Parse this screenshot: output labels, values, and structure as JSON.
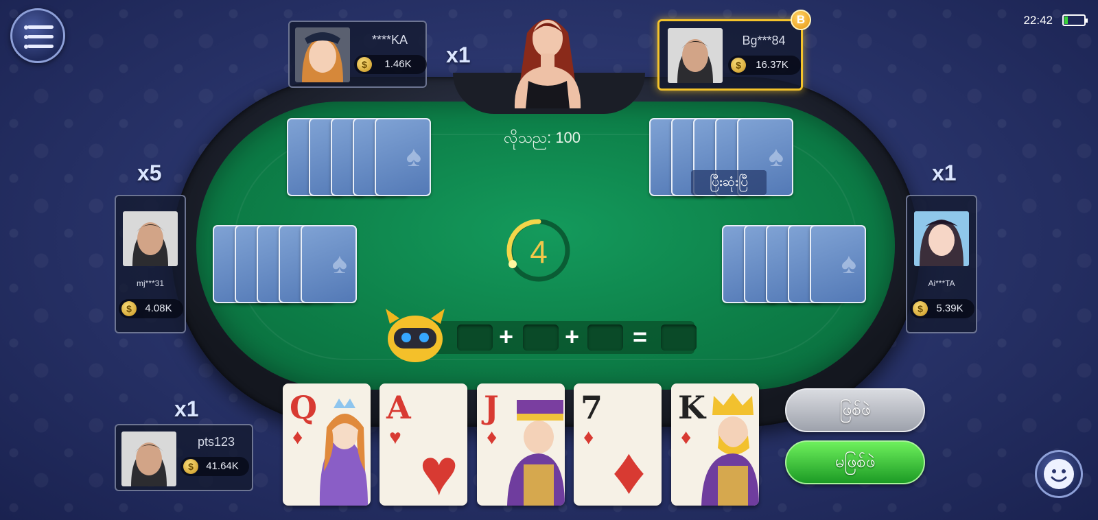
{
  "status_bar": {
    "time": "22:42",
    "battery_color": "#3ad13a"
  },
  "table": {
    "bet_label": "လိုသည: 100",
    "finished_tag": "ပြီးဆုံးပြီ",
    "timer_value": "4",
    "equation": {
      "op1": "+",
      "op2": "+",
      "op3": "="
    }
  },
  "players": {
    "top_left": {
      "name": "****KA",
      "coins": "1.46K",
      "multiplier": "x1"
    },
    "top_right": {
      "name": "Bg***84",
      "coins": "16.37K",
      "badge": "B"
    },
    "left": {
      "name": "mj***31",
      "coins": "4.08K",
      "multiplier": "x5"
    },
    "right": {
      "name": "Ai***TA",
      "coins": "5.39K",
      "multiplier": "x1"
    },
    "self": {
      "name": "pts123",
      "coins": "41.64K",
      "multiplier": "x1"
    }
  },
  "hand": [
    {
      "rank": "Q",
      "suit": "♦",
      "color": "red"
    },
    {
      "rank": "A",
      "suit": "♥",
      "color": "red"
    },
    {
      "rank": "J",
      "suit": "♦",
      "color": "red"
    },
    {
      "rank": "7",
      "suit": "♦",
      "color": "red"
    },
    {
      "rank": "K",
      "suit": "♦",
      "color": "red"
    }
  ],
  "buttons": {
    "has_bull": "ဖြစ်ဖဲ",
    "no_bull": "မဖြစ်ဖဲ"
  },
  "icons": [
    "menu-icon",
    "battery-icon",
    "coin-icon",
    "timer-icon",
    "robot-icon",
    "smile-icon",
    "spade-icon"
  ],
  "colors": {
    "felt": "#0d7f48",
    "active_border": "#f4c32b",
    "timer": "#f3c74a"
  }
}
